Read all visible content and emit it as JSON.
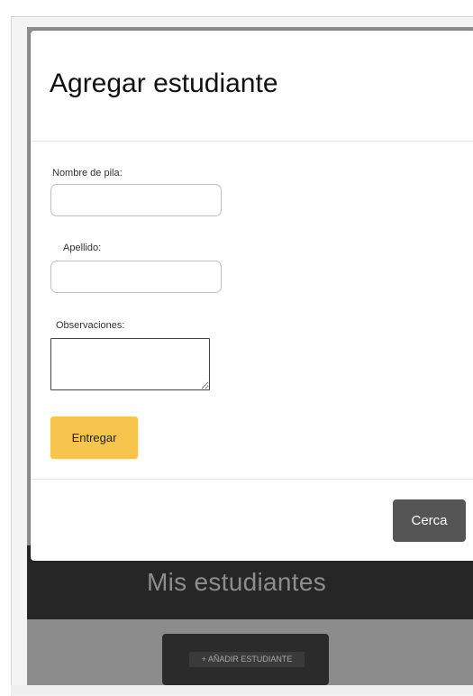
{
  "modal": {
    "title": "Agregar estudiante",
    "fields": {
      "first_name": {
        "label": "Nombre de pila:",
        "value": ""
      },
      "last_name": {
        "label": "Apellido:",
        "value": ""
      },
      "notes": {
        "label": "Observaciones:",
        "value": ""
      }
    },
    "submit_label": "Entregar",
    "close_label": "Cerca"
  },
  "background_page": {
    "title": "Mis estudiantes",
    "add_button_label": "+ AÑADIR ESTUDIANTE"
  },
  "colors": {
    "submit_button": "#f7c44d",
    "close_button": "#555555",
    "header_bar": "#262626",
    "overlay": "#8e8e8e"
  }
}
